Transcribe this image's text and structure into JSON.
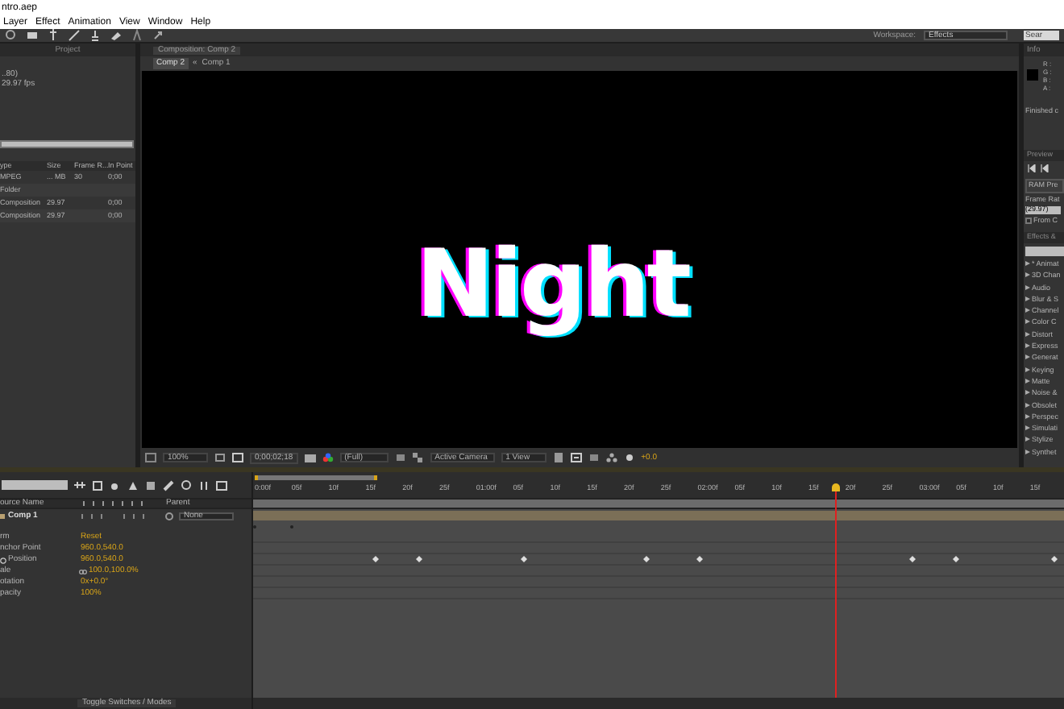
{
  "app": {
    "title": "ntro.aep",
    "menu": [
      "Layer",
      "Effect",
      "Animation",
      "View",
      "Window",
      "Help"
    ],
    "workspace_label": "Workspace:",
    "workspace": "Effects",
    "search_placeholder": "Sear"
  },
  "project": {
    "tab": "Project",
    "info": [
      "..80)",
      "29.97 fps"
    ],
    "columns": [
      "ype",
      "Size",
      "Frame R...",
      "In Point"
    ],
    "rows": [
      [
        "MPEG",
        "... MB",
        "30",
        "0;00"
      ],
      [
        "Folder",
        "",
        "",
        ""
      ],
      [
        "Composition",
        "29.97",
        "",
        "0;00"
      ],
      [
        "Composition",
        "29.97",
        "",
        "0;00"
      ]
    ]
  },
  "viewer": {
    "tab": "Composition: Comp 2",
    "breadcrumbs": [
      "Comp 2",
      "Comp 1"
    ],
    "separator": "«",
    "canvas_text": "Night",
    "controls": {
      "zoom": "100%",
      "time": "0;00;02;18",
      "resolution": "(Full)",
      "camera": "Active Camera",
      "views": "1 View",
      "exposure": "+0.0"
    }
  },
  "info": {
    "tab": "Info",
    "channels": [
      "R :",
      "G :",
      "B :",
      "A :"
    ],
    "status": "Finished c"
  },
  "preview": {
    "tab": "Preview",
    "ram_button": "RAM Pre",
    "frame_rate_label": "Frame Rat",
    "frame_rate": "(29.97)",
    "from_current": {
      "label": "From C",
      "checked": false
    }
  },
  "effects": {
    "tab": "Effects &",
    "items": [
      "* Animat",
      "3D Chan",
      "Audio",
      "Blur & S",
      "Channel",
      "Color C",
      "Distort",
      "Express",
      "Generat",
      "Keying",
      "Matte",
      "Noise &",
      "Obsolet",
      "Perspec",
      "Simulati",
      "Stylize",
      "Synthet"
    ]
  },
  "timeline": {
    "ruler": [
      "0:00f",
      "05f",
      "10f",
      "15f",
      "20f",
      "25f",
      "01:00f",
      "05f",
      "10f",
      "15f",
      "20f",
      "25f",
      "02:00f",
      "05f",
      "10f",
      "15f",
      "20f",
      "25f",
      "03:00f",
      "05f",
      "10f",
      "15f"
    ],
    "columns": {
      "name": "ource Name",
      "parent": "Parent"
    },
    "layer": {
      "name": "Comp 1",
      "parent": "None"
    },
    "properties": [
      {
        "name": "rm",
        "value": "Reset"
      },
      {
        "name": "nchor Point",
        "value": "960.0,540.0"
      },
      {
        "name": "Position",
        "value": "960.0,540.0"
      },
      {
        "name": "ale",
        "value": "100.0,100.0%"
      },
      {
        "name": "otation",
        "value": "0x+0.0°"
      },
      {
        "name": "pacity",
        "value": "100%"
      }
    ],
    "footer": "Toggle Switches / Modes"
  }
}
